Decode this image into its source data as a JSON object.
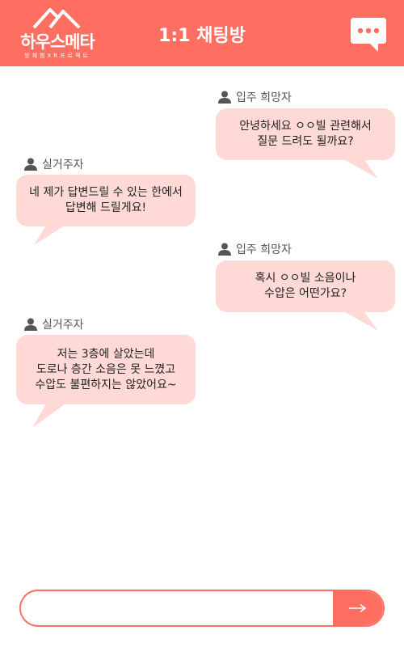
{
  "header": {
    "logo_title": "하우스메타",
    "logo_subtitle": "방체험XR프로젝트",
    "title": "1:1 채팅방",
    "chat_icon": "chat-bubble-icon",
    "colors": {
      "brand": "#ff6f61",
      "bubble": "#ffd9d6"
    }
  },
  "messages": [
    {
      "role": "sent",
      "sender": "입주 희망자",
      "lines": [
        "안녕하세요 ㅇㅇ빌 관련해서",
        "질문 드려도 될까요?"
      ]
    },
    {
      "role": "received",
      "sender": "실거주자",
      "lines": [
        "네 제가 답변드릴 수 있는 한에서",
        "답변해 드릴게요!"
      ]
    },
    {
      "role": "sent",
      "sender": "입주 희망자",
      "lines": [
        "혹시 ㅇㅇ빌 소음이나",
        "수압은 어떤가요?"
      ]
    },
    {
      "role": "received",
      "sender": "실거주자",
      "lines": [
        "저는 3층에 살았는데",
        "도로나 층간 소음은 못 느꼈고",
        "수압도 불편하지는 않았어요~"
      ]
    }
  ],
  "composer": {
    "input_value": "",
    "input_placeholder": "",
    "send_icon": "arrow-right-icon"
  }
}
